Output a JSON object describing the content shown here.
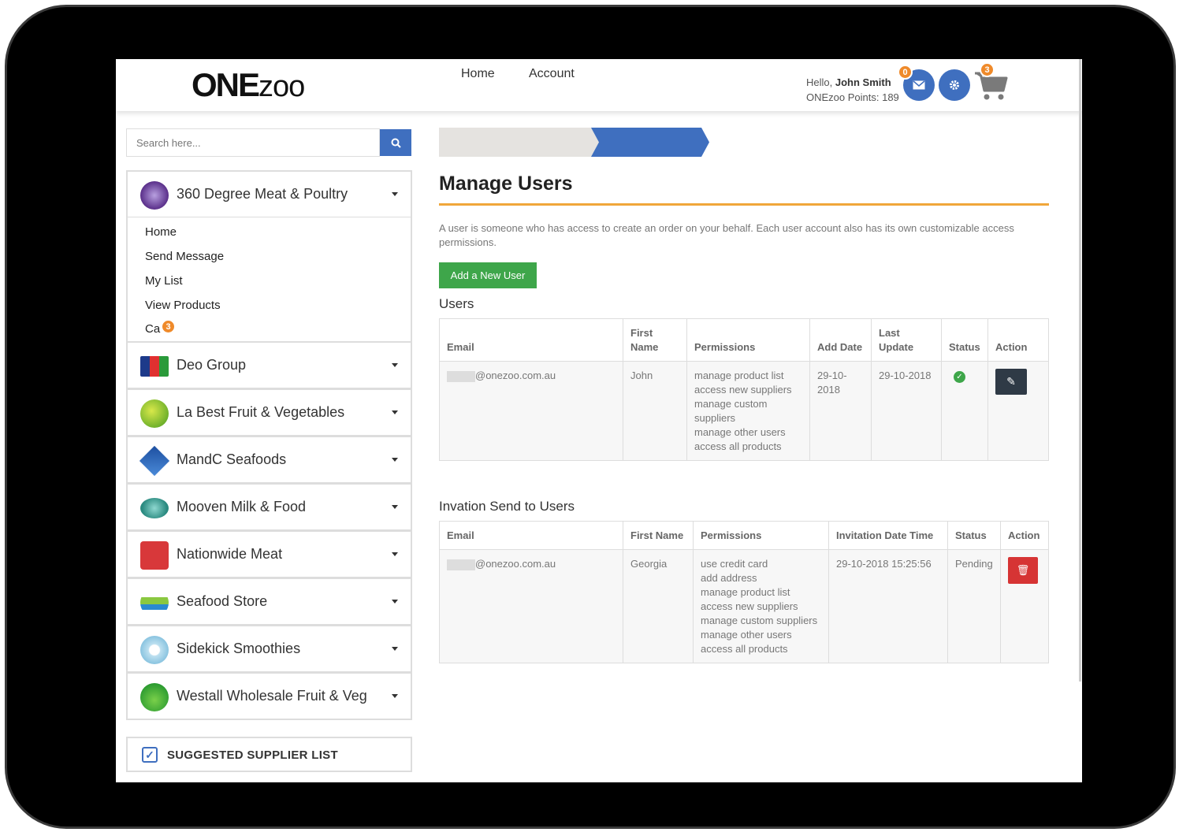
{
  "header": {
    "logo_one": "ONE",
    "logo_zoo": "zoo",
    "hello_prefix": "Hello, ",
    "user_name": "John Smith",
    "points": "ONEzoo Points: 189",
    "messages_count": "0",
    "cart_count": "3",
    "icons": {
      "messages": "envelope-icon",
      "settings": "gear-icon",
      "cart": "cart-icon"
    },
    "accent_color": "#3f6fbf",
    "badge_color": "#ef8a2a"
  },
  "sidebar": {
    "search_placeholder": "Search here...",
    "suppliers": [
      {
        "name": "360 Degree Meat & Poultry"
      },
      {
        "name": "Deo Group"
      },
      {
        "name": "La Best Fruit & Vegetables"
      },
      {
        "name": "MandC Seafoods"
      },
      {
        "name": "Mooven Milk & Food"
      },
      {
        "name": "Nationwide Meat"
      },
      {
        "name": "Seafood Store"
      },
      {
        "name": "Sidekick Smoothies"
      },
      {
        "name": "Westall Wholesale Fruit & Veg"
      }
    ],
    "submenu": [
      "Home",
      "Send Message",
      "My List",
      "View Products",
      "Ca"
    ],
    "submenu_badge": "3",
    "suggested": "SUGGESTED SUPPLIER LIST"
  },
  "breadcrumb": [
    "Home",
    "Account",
    "Manage Users"
  ],
  "page": {
    "title": "Manage Users",
    "description": "A user is someone who has access to create an order on your behalf. Each user account also has its own customizable access permissions.",
    "add_button": "Add a New User",
    "users_heading": "Users",
    "invitations_heading": "Invation Send to Users"
  },
  "users_table": {
    "headers": [
      "Email",
      "First Name",
      "Permissions",
      "Add Date",
      "Last Update",
      "Status",
      "Action"
    ],
    "rows": [
      {
        "email_domain": "@onezoo.com.au",
        "first_name": "John",
        "permissions": [
          "manage product list",
          "access new suppliers",
          "manage custom suppliers",
          "manage other users",
          "access all products"
        ],
        "add_date": "29-10-2018",
        "last_update": "29-10-2018",
        "status": "active"
      }
    ]
  },
  "invites_table": {
    "headers": [
      "Email",
      "First Name",
      "Permissions",
      "Invitation Date Time",
      "Status",
      "Action"
    ],
    "rows": [
      {
        "email_domain": "@onezoo.com.au",
        "first_name": "Georgia",
        "permissions": [
          "use credit card",
          "add address",
          "manage product list",
          "access new suppliers",
          "manage custom suppliers",
          "manage other users",
          "access all products"
        ],
        "invited": "29-10-2018 15:25:56",
        "status": "Pending"
      }
    ]
  }
}
